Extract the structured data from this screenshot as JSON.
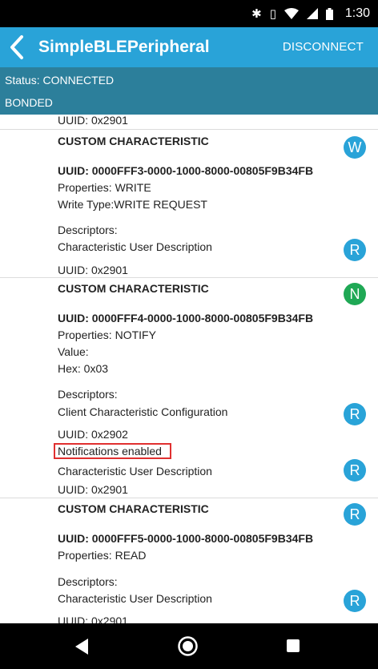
{
  "status_bar": {
    "time": "1:30",
    "icons": [
      "bluetooth-icon",
      "vibrate-icon",
      "wifi-icon",
      "signal-icon",
      "battery-icon"
    ]
  },
  "app_bar": {
    "title": "SimpleBLEPeripheral",
    "action_label": "DISCONNECT",
    "color": "#29a3d8"
  },
  "connection": {
    "status": "Status: CONNECTED",
    "bond": "BONDED",
    "color": "#2c7f9b"
  },
  "list": {
    "partial_top_uuid": "UUID: 0x2901",
    "characteristics": [
      {
        "title": "CUSTOM CHARACTERISTIC",
        "badge": "W",
        "uuid": "UUID: 0000FFF3-0000-1000-8000-00805F9B34FB",
        "properties": "Properties: WRITE",
        "write_type": "Write Type:WRITE REQUEST",
        "descriptors_label": "Descriptors:",
        "descriptors": [
          {
            "name": "Characteristic User Description",
            "uuid": "UUID: 0x2901",
            "badge": "R"
          }
        ]
      },
      {
        "title": "CUSTOM CHARACTERISTIC",
        "badge": "N",
        "uuid": "UUID: 0000FFF4-0000-1000-8000-00805F9B34FB",
        "properties": "Properties: NOTIFY",
        "value_label": "Value:",
        "hex": "Hex: 0x03",
        "descriptors_label": "Descriptors:",
        "descriptors": [
          {
            "name": "Client Characteristic Configuration",
            "uuid": "UUID: 0x2902",
            "badge": "R",
            "note": "Notifications enabled"
          },
          {
            "name": "Characteristic User Description",
            "uuid": "UUID: 0x2901",
            "badge": "R"
          }
        ]
      },
      {
        "title": "CUSTOM CHARACTERISTIC",
        "badge": "R",
        "uuid": "UUID: 0000FFF5-0000-1000-8000-00805F9B34FB",
        "properties": "Properties: READ",
        "descriptors_label": "Descriptors:",
        "descriptors": [
          {
            "name": "Characteristic User Description",
            "uuid": "UUID: 0x2901",
            "badge": "R"
          }
        ]
      }
    ]
  },
  "badge_colors": {
    "blue": "#29a3d8",
    "green": "#1fa855"
  },
  "nav_bar": {
    "buttons": [
      "back-triangle-icon",
      "home-circle-icon",
      "recents-square-icon"
    ]
  }
}
